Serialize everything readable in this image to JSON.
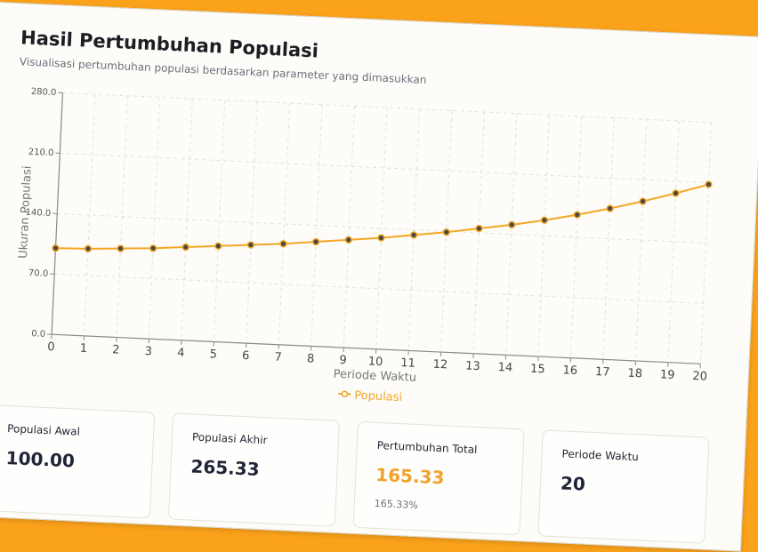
{
  "header": {
    "title": "Hasil Pertumbuhan Populasi",
    "subtitle": "Visualisasi pertumbuhan populasi berdasarkan parameter yang dimasukkan"
  },
  "chart_data": {
    "type": "line",
    "xlabel": "Periode Waktu",
    "ylabel": "Ukuran Populasi",
    "x": [
      0,
      1,
      2,
      3,
      4,
      5,
      6,
      7,
      8,
      9,
      10,
      11,
      12,
      13,
      14,
      15,
      16,
      17,
      18,
      19,
      20
    ],
    "series": [
      {
        "name": "Populasi",
        "color": "#f5a623",
        "values": [
          100.0,
          101.0,
          103.0,
          105.0,
          108.0,
          111.0,
          114.0,
          117.0,
          121.0,
          125.0,
          129.0,
          134.0,
          139.0,
          145.0,
          151.0,
          158.0,
          166.0,
          175.0,
          185.0,
          196.0,
          208.0
        ]
      }
    ],
    "ylim": [
      0,
      280
    ],
    "yticks": [
      "0.0",
      "70.0",
      "140.0",
      "210.0",
      "280.0"
    ],
    "xticks": [
      "0",
      "1",
      "2",
      "3",
      "4",
      "5",
      "6",
      "7",
      "8",
      "9",
      "10",
      "11",
      "12",
      "13",
      "14",
      "15",
      "16",
      "17",
      "18",
      "19",
      "20"
    ],
    "grid": true,
    "legend_position": "bottom-center"
  },
  "stats": [
    {
      "label": "Populasi Awal",
      "value": "100.00"
    },
    {
      "label": "Populasi Akhir",
      "value": "265.33"
    },
    {
      "label": "Pertumbuhan Total",
      "value": "165.33",
      "sub": "165.33%"
    },
    {
      "label": "Periode Waktu",
      "value": "20"
    }
  ],
  "colors": {
    "background": "#fba21b",
    "accent": "#f2a12c",
    "line": "#f5a623"
  }
}
